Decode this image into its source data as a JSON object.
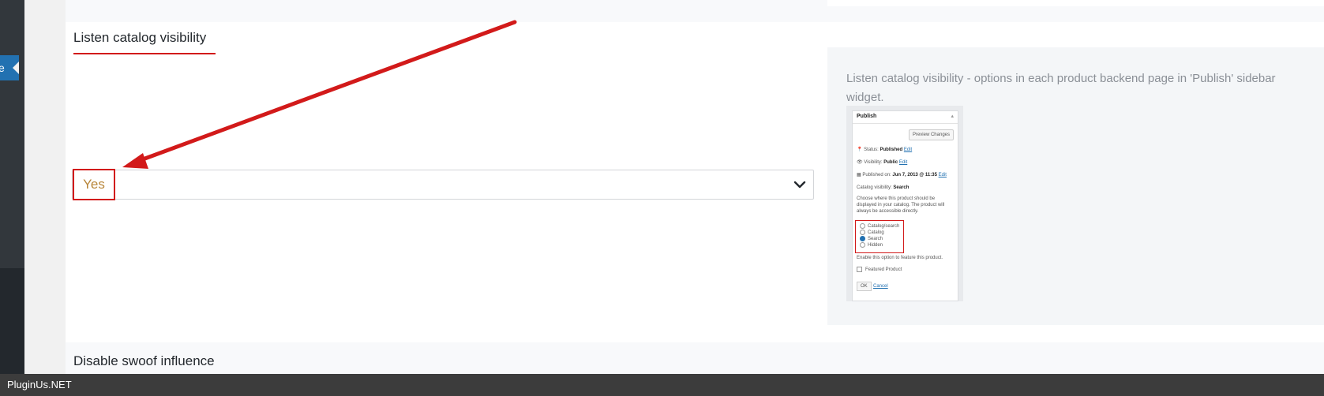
{
  "sidebar": {
    "active_item_label": "e"
  },
  "section": {
    "heading": "Listen catalog visibility"
  },
  "select": {
    "value": "Yes",
    "chevron": "chevron-down-icon"
  },
  "help": {
    "text": "Listen catalog visibility - options in each product backend page in 'Publish' sidebar widget.",
    "screenshot": {
      "title": "Publish",
      "preview_button": "Preview Changes",
      "status_label": "Status:",
      "status_value": "Published",
      "edit": "Edit",
      "visibility_label": "Visibility:",
      "visibility_value": "Public",
      "published_label": "Published on:",
      "published_value": "Jun 7, 2013 @ 11:35",
      "catalog_visibility_label": "Catalog visibility:",
      "catalog_visibility_value": "Search",
      "description": "Choose where this product should be displayed in your catalog. The product will always be accessible directly.",
      "options": [
        "Catalog/search",
        "Catalog",
        "Search",
        "Hidden"
      ],
      "selected_option": "Search",
      "feature_hint": "Enable this option to feature this product.",
      "featured_label": "Featured Product",
      "ok": "OK",
      "cancel": "Cancel"
    }
  },
  "next_section": {
    "heading": "Disable swoof influence"
  },
  "footer": {
    "brand": "PluginUs.NET"
  },
  "colors": {
    "accent_red": "#d21a1a",
    "value_text": "#b8863a",
    "wp_blue": "#2271b1"
  }
}
